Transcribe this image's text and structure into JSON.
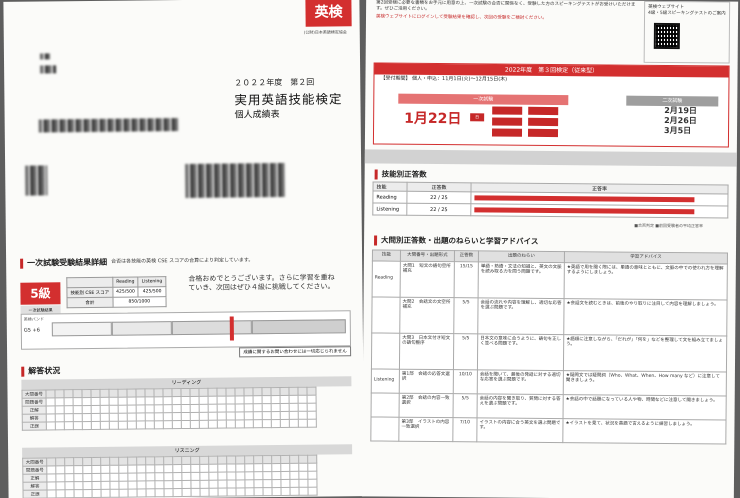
{
  "left": {
    "logo": "英検",
    "logo_sub": "(公財)日本英語検定協会",
    "year": "２０２２年度　第２回",
    "title": "実用英語技能検定",
    "subtitle": "個人成績表",
    "section1_title": "一次試験受験結果詳細",
    "section1_note": "合否は各技能の英検 CSE スコアの合算により判定しています。",
    "grade": "5級",
    "grade_label": "一次試験結果",
    "result": "合　格",
    "score_headers": [
      "Reading",
      "Listening"
    ],
    "score_row_label": "技能別 CSE スコア",
    "scores": [
      "425/500",
      "425/500"
    ],
    "total_label": "合計",
    "total": "850/1000",
    "message": "合格おめでとうございます。さらに学習を重ねていき、次回はぜひ４級に挑戦してください。",
    "band_label": "英検バンド",
    "band_value": "G5 +6",
    "contact": "成績に関するお問い合わせには一切応じられません",
    "section2_title": "解答状況",
    "reading_label": "リーディング",
    "listening_label": "リスニング",
    "grid_labels": [
      "大問番号",
      "問題番号",
      "正解",
      "解答",
      "正誤"
    ]
  },
  "right": {
    "promo": "第2回受検に必要な書類をお手元に用意の上、一次試験の合否に関係なく、受験した方のスピーキングテストがお受けいただけます。ぜひご活用ください。",
    "promo2": "英検ウェブサイトにログインして受験結果を確認し、次回の受験をご検討ください。",
    "qr_label": "英検ウェブサイト\n4級・5級スピーキングテストのご案内",
    "exam_head": "2022年度　第３回検定（従来型）",
    "exam_sub": "【受付期間】 個人・申込：11月1日(火)〜12月15日(木)",
    "stage1": "一次試験",
    "stage2": "二次試験",
    "date1": "1月22日",
    "date1_day": "日",
    "date2_lines": [
      "2月19日",
      "2月26日",
      "3月5日"
    ],
    "skill_title": "技能別正答数",
    "skill_headers": [
      "技能",
      "正答数",
      "正答率"
    ],
    "skills": [
      {
        "name": "Reading",
        "count": "22 / 25",
        "rate": 0.88
      },
      {
        "name": "Listening",
        "count": "22 / 25",
        "rate": 0.88
      }
    ],
    "legend": "■合否判定 ■前回受験者の平均正答率",
    "advice_title": "大問別正答数・出題のねらいと学習アドバイス",
    "advice_headers": [
      "技能",
      "大問番号・出題形式",
      "正答数",
      "出題のねらい",
      "学習アドバイス"
    ],
    "advice_rows": [
      {
        "skill": "Reading",
        "item": "大問1　短文の語句空所補充",
        "count": "15/15",
        "aim": "単語・熟語・文法の知識と、英文の文脈を読み取る力を問う問題です。",
        "advice": "★英語で用を聞く際には、単語の意味とともに、文脈の中での使われ方を理解するようにしましょう。"
      },
      {
        "skill": "",
        "item": "大問2　会話文の文空所補充",
        "count": "5/5",
        "aim": "会話の流れや内容を理解し、適切な応答を選ぶ問題です。",
        "advice": "★会話文を読むときは、前後のやり取りに注目して内容を理解しましょう。"
      },
      {
        "skill": "",
        "item": "大問3　日本文付き短文の語句整序",
        "count": "5/5",
        "aim": "日本文の意味に合うように、語句を正しく並べる問題です。",
        "advice": "★語順に注意しながら、「だれが」「何を」などを整理して文を組み立てましょう。"
      },
      {
        "skill": "Listening",
        "item": "第1部　会話の応答文選択",
        "count": "10/10",
        "aim": "会話を聞いて、最後の発話に対する適切な応答を選ぶ問題です。",
        "advice": "★疑問文では疑問詞（Who、What、When、How many など）に注意して聞きましょう。"
      },
      {
        "skill": "",
        "item": "第2部　会話の内容一致選択",
        "count": "5/5",
        "aim": "会話の内容を聞き取り、質問に対する答えを選ぶ問題です。",
        "advice": "★会話の中で話題になっている人や物、時間などに注意して聞きましょう。"
      },
      {
        "skill": "",
        "item": "第3部　イラストの内容一致選択",
        "count": "7/10",
        "aim": "イラストの内容に合う英文を選ぶ問題です。",
        "advice": "★イラストを見て、状況を英語で言えるように練習しましょう。"
      }
    ]
  },
  "colors": {
    "brand_red": "#d32f2f"
  }
}
